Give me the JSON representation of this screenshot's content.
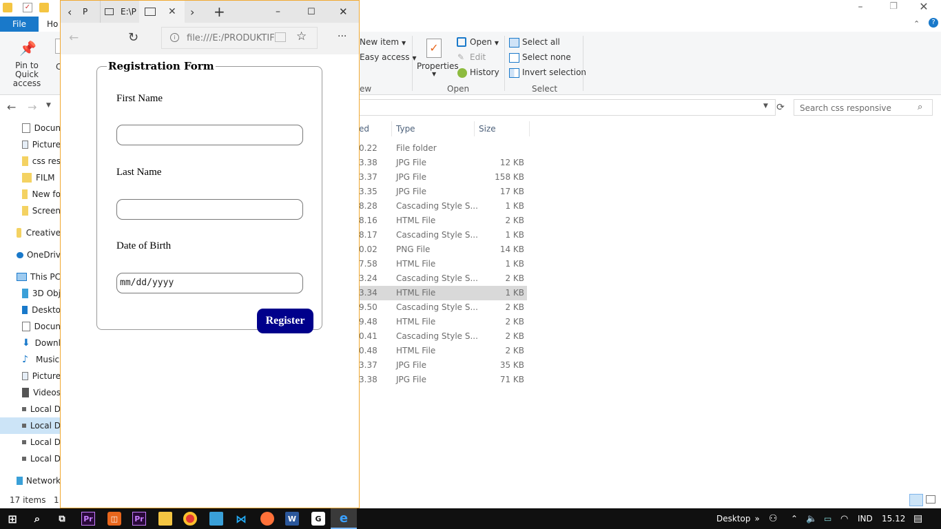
{
  "explorer": {
    "tabs": {
      "file": "File",
      "home": "Ho"
    },
    "ribbon": {
      "pin_quick_access": "Pin to Quick access",
      "new_item": "New item",
      "easy_access": "Easy access",
      "properties": "Properties",
      "open": "Open",
      "edit": "Edit",
      "history": "History",
      "select_all": "Select all",
      "select_none": "Select none",
      "invert_selection": "Invert selection",
      "group_new": "ew",
      "group_open": "Open",
      "group_select": "Select"
    },
    "search_placeholder": "Search css responsive",
    "nav_items": [
      "Docun",
      "Picture",
      "css res",
      "FILM",
      "New fo",
      "Screen",
      "Creative",
      "OneDriv",
      "This PC",
      "3D Obj",
      "Deskto",
      "Docun",
      "Downl",
      "Music",
      "Picture",
      "Videos",
      "Local D",
      "Local D",
      "Local D",
      "Local D",
      "Network"
    ],
    "columns": {
      "date": "ed",
      "type": "Type",
      "size": "Size"
    },
    "rows": [
      {
        "date": "0.22",
        "type": "File folder",
        "size": ""
      },
      {
        "date": "3.38",
        "type": "JPG File",
        "size": "12 KB"
      },
      {
        "date": "3.37",
        "type": "JPG File",
        "size": "158 KB"
      },
      {
        "date": "3.35",
        "type": "JPG File",
        "size": "17 KB"
      },
      {
        "date": "8.28",
        "type": "Cascading Style S...",
        "size": "1 KB"
      },
      {
        "date": "8.16",
        "type": "HTML File",
        "size": "2 KB"
      },
      {
        "date": "8.17",
        "type": "Cascading Style S...",
        "size": "1 KB"
      },
      {
        "date": "0.02",
        "type": "PNG File",
        "size": "14 KB"
      },
      {
        "date": "7.58",
        "type": "HTML File",
        "size": "1 KB"
      },
      {
        "date": "3.24",
        "type": "Cascading Style S...",
        "size": "2 KB"
      },
      {
        "date": "3.34",
        "type": "HTML File",
        "size": "1 KB"
      },
      {
        "date": "9.50",
        "type": "Cascading Style S...",
        "size": "2 KB"
      },
      {
        "date": "9.48",
        "type": "HTML File",
        "size": "2 KB"
      },
      {
        "date": "0.41",
        "type": "Cascading Style S...",
        "size": "2 KB"
      },
      {
        "date": "0.48",
        "type": "HTML File",
        "size": "2 KB"
      },
      {
        "date": "3.37",
        "type": "JPG File",
        "size": "35 KB"
      },
      {
        "date": "3.38",
        "type": "JPG File",
        "size": "71 KB"
      }
    ],
    "selected_row_index": 10,
    "status": {
      "items": "17 items",
      "extra": "1"
    }
  },
  "edge": {
    "tab1": "P",
    "tab2": "E:\\P",
    "url": "file:///E:/PRODUKTIF",
    "more": "···"
  },
  "form": {
    "legend": "Registration Form",
    "first_name_label": "First Name",
    "last_name_label": "Last Name",
    "dob_label": "Date of Birth",
    "dob_value": "mm/dd/yyyy",
    "register": "Register"
  },
  "taskbar": {
    "desktop": "Desktop",
    "lang": "IND",
    "time": "15.12",
    "chevrons": "»"
  },
  "colors": {
    "accent": "#1979ca",
    "button": "#00008b",
    "edge_border": "#f0a830",
    "taskbar": "#101010"
  }
}
